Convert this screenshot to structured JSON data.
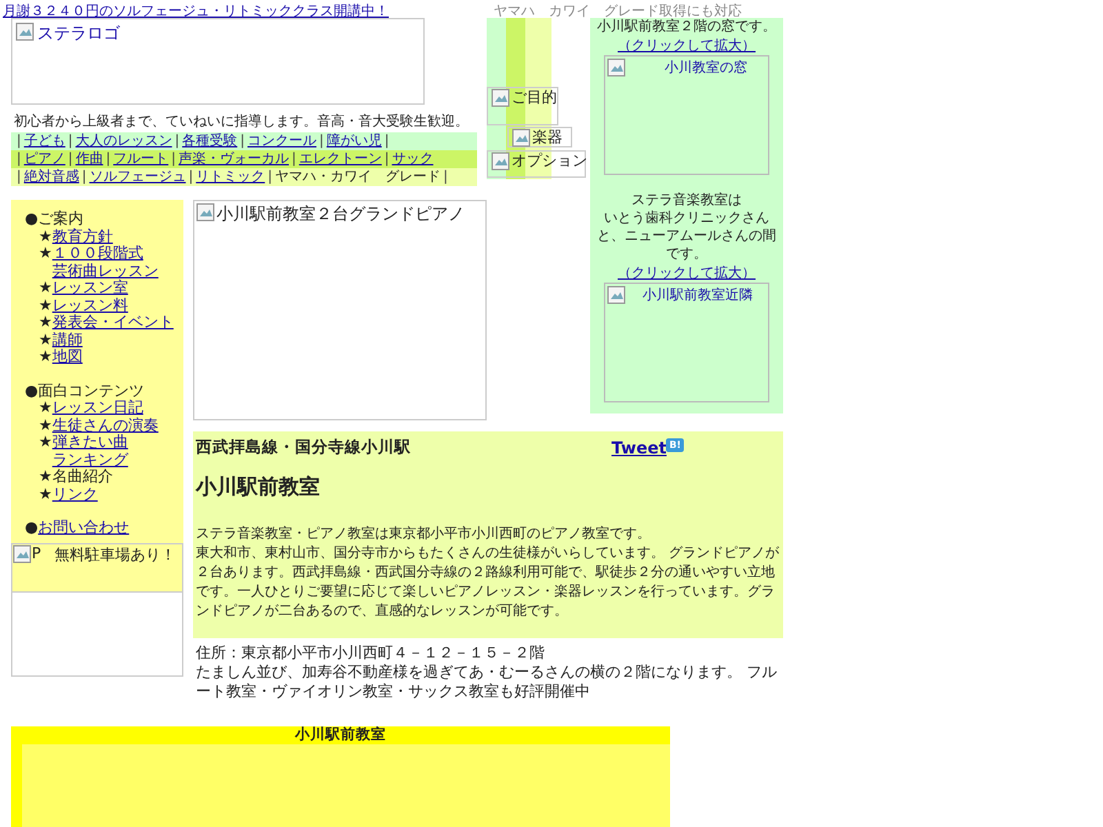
{
  "top_bar": {
    "announcement": "月謝３２４０円のソルフェージュ・リトミッククラス開講中！",
    "note": "ヤマハ　カワイ　グレード取得にも対応"
  },
  "header": {
    "logo_alt": "ステラロゴ",
    "tagline": "初心者から上級者まで、ていねいに指導します。音高・音大受験生歓迎。",
    "separator": "|",
    "nav_rows": [
      {
        "items": [
          {
            "label": "子ども",
            "kind": "link"
          },
          {
            "label": "大人のレッスン",
            "kind": "link"
          },
          {
            "label": "各種受験",
            "kind": "link"
          },
          {
            "label": "コンクール",
            "kind": "link"
          },
          {
            "label": "障がい児",
            "kind": "link"
          }
        ],
        "trailing_separator": true
      },
      {
        "items": [
          {
            "label": "ピアノ",
            "kind": "link"
          },
          {
            "label": "作曲",
            "kind": "link"
          },
          {
            "label": "フルート",
            "kind": "link"
          },
          {
            "label": "声楽・ヴォーカル",
            "kind": "link"
          },
          {
            "label": "エレクトーン",
            "kind": "link"
          },
          {
            "label": "サック",
            "kind": "link"
          }
        ],
        "trailing_separator": false
      },
      {
        "items": [
          {
            "label": "絶対音感",
            "kind": "link"
          },
          {
            "label": "ソルフェージュ",
            "kind": "link"
          },
          {
            "label": "リトミック",
            "kind": "link"
          },
          {
            "label": "ヤマハ・カワイ　グレード",
            "kind": "plain"
          }
        ],
        "trailing_separator": true
      }
    ]
  },
  "menu_images": [
    "ご目的",
    "楽器",
    "オプション"
  ],
  "right_panel": {
    "window_text": "小川駅前教室２階の窓です。",
    "window_link": "（クリックして拡大）",
    "window_image_alt": "小川教室の窓",
    "location_lines": [
      "ステラ音楽教室は",
      "いとう歯科クリニックさん",
      "と、ニューアムールさんの間",
      "です。"
    ],
    "location_link": "（クリックして拡大）",
    "location_image_alt": "小川駅前教室近隣"
  },
  "sidebar": {
    "groups": [
      {
        "bullet": "●",
        "title": {
          "label": "ご案内",
          "kind": "plain"
        },
        "items": [
          {
            "star": "★",
            "lines": [
              "教育方針"
            ],
            "kind": "link"
          },
          {
            "star": "★",
            "lines": [
              "１００段階式",
              "芸術曲レッスン"
            ],
            "kind": "link"
          },
          {
            "star": "★",
            "lines": [
              "レッスン室"
            ],
            "kind": "link"
          },
          {
            "star": "★",
            "lines": [
              "レッスン料"
            ],
            "kind": "link"
          },
          {
            "star": "★",
            "lines": [
              "発表会・イベント"
            ],
            "kind": "link"
          },
          {
            "star": "★",
            "lines": [
              "講師"
            ],
            "kind": "link"
          },
          {
            "star": "★",
            "lines": [
              "地図"
            ],
            "kind": "link"
          }
        ]
      },
      {
        "bullet": "●",
        "title": {
          "label": "面白コンテンツ",
          "kind": "plain"
        },
        "items": [
          {
            "star": "★",
            "lines": [
              "レッスン日記"
            ],
            "kind": "link"
          },
          {
            "star": "★",
            "lines": [
              "生徒さんの演奏"
            ],
            "kind": "link"
          },
          {
            "star": "★",
            "lines": [
              "弾きたい曲",
              "ランキング"
            ],
            "kind": "link"
          },
          {
            "star": "★",
            "lines": [
              "名曲紹介"
            ],
            "kind": "plain"
          },
          {
            "star": "★",
            "lines": [
              "リンク"
            ],
            "kind": "link"
          }
        ]
      },
      {
        "bullet": "●",
        "title": {
          "label": "お問い合わせ",
          "kind": "link"
        }
      }
    ],
    "parking_image_alt": "P",
    "parking_text": "無料駐車場あり！"
  },
  "piano_image_alt": "小川駅前教室２台グランドピアノ",
  "info": {
    "station": "西武拝島線・国分寺線小川駅",
    "tweet": "Tweet",
    "bookmark": "B!",
    "heading": "小川駅前教室",
    "paragraphs": [
      "ステラ音楽教室・ピアノ教室は東京都小平市小川西町のピアノ教室です。",
      "東大和市、東村山市、国分寺市からもたくさんの生徒様がいらしています。 グランドピアノが２台あります。西武拝島線・西武国分寺線の２路線利用可能で、駅徒歩２分の通いやすい立地です。一人ひとりご要望に応じて楽しいピアノレッスン・楽器レッスンを行っています。グランドピアノが二台あるので、直感的なレッスンが可能です。"
    ]
  },
  "address": {
    "line": "住所：東京都小平市小川西町４－１２－１５－２階",
    "directions": "たましん並び、加寿谷不動産様を過ぎてあ・むーるさんの横の２階になります。 フルート教室・ヴァイオリン教室・サックス教室も好評開催中"
  },
  "footer_box": {
    "title": "小川駅前教室"
  }
}
